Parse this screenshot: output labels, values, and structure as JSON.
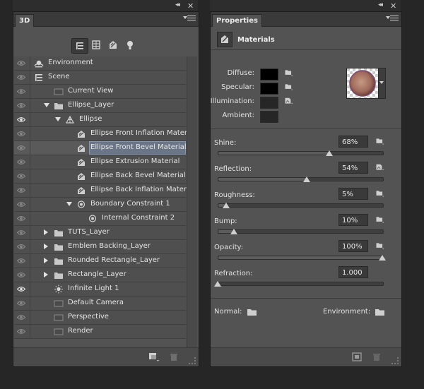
{
  "panel_3d": {
    "title": "3D",
    "filters": [
      {
        "name": "scene-filter-icon",
        "active": true
      },
      {
        "name": "mesh-filter-icon",
        "active": false
      },
      {
        "name": "material-filter-icon",
        "active": false
      },
      {
        "name": "light-filter-icon",
        "active": false
      }
    ],
    "rows": [
      {
        "label": "Environment",
        "depth": 0,
        "icon": "environment",
        "expand": "",
        "eye": true
      },
      {
        "label": "Scene",
        "depth": 0,
        "icon": "scene",
        "expand": "",
        "eye": true
      },
      {
        "label": "Current View",
        "depth": 1,
        "icon": "camera",
        "expand": "",
        "eye": true
      },
      {
        "label": "Ellipse_Layer",
        "depth": 1,
        "icon": "folder",
        "expand": "down",
        "eye": true
      },
      {
        "label": "Ellipse",
        "depth": 2,
        "icon": "mesh",
        "expand": "down",
        "eye": true
      },
      {
        "label": "Ellipse Front Inflation Material",
        "depth": 3,
        "icon": "material",
        "expand": "",
        "eye": true
      },
      {
        "label": "Ellipse Front Bevel Material",
        "depth": 3,
        "icon": "material",
        "expand": "",
        "eye": true,
        "selected": true
      },
      {
        "label": "Ellipse Extrusion Material",
        "depth": 3,
        "icon": "material",
        "expand": "",
        "eye": true
      },
      {
        "label": "Ellipse Back Bevel Material",
        "depth": 3,
        "icon": "material",
        "expand": "",
        "eye": true
      },
      {
        "label": "Ellipse Back Inflation Material",
        "depth": 3,
        "icon": "material",
        "expand": "",
        "eye": true
      },
      {
        "label": "Boundary Constraint 1",
        "depth": 3,
        "icon": "constraint",
        "expand": "down",
        "eye": true
      },
      {
        "label": "Internal Constraint 2",
        "depth": 4,
        "icon": "constraint",
        "expand": "",
        "eye": true
      },
      {
        "label": "TUTS_Layer",
        "depth": 1,
        "icon": "folder",
        "expand": "right",
        "eye": true
      },
      {
        "label": "Emblem Backing_Layer",
        "depth": 1,
        "icon": "folder",
        "expand": "right",
        "eye": true
      },
      {
        "label": "Rounded Rectangle_Layer",
        "depth": 1,
        "icon": "folder",
        "expand": "right",
        "eye": true
      },
      {
        "label": "Rectangle_Layer",
        "depth": 1,
        "icon": "folder",
        "expand": "right",
        "eye": true
      },
      {
        "label": "Infinite Light 1",
        "depth": 1,
        "icon": "light",
        "expand": "",
        "eye": true
      },
      {
        "label": "Default Camera",
        "depth": 1,
        "icon": "camera",
        "expand": "",
        "eye": true
      },
      {
        "label": "Perspective",
        "depth": 1,
        "icon": "camera",
        "expand": "",
        "eye": true
      },
      {
        "label": "Render",
        "depth": 1,
        "icon": "camera",
        "expand": "",
        "eye": true
      }
    ]
  },
  "properties": {
    "tab_title": "Properties",
    "section_title": "Materials",
    "colors": [
      {
        "label": "Diffuse:",
        "color": "#000000"
      },
      {
        "label": "Specular:",
        "color": "#000000"
      },
      {
        "label": "Illumination:",
        "color": "#262626"
      },
      {
        "label": "Ambient:",
        "color": "#262626"
      }
    ],
    "sliders": [
      {
        "label": "Shine:",
        "value": "68%",
        "level": 0.68
      },
      {
        "label": "Reflection:",
        "value": "54%",
        "level": 0.54
      },
      {
        "label": "Roughness:",
        "value": "5%",
        "level": 0.05
      },
      {
        "label": "Bump:",
        "value": "10%",
        "level": 0.1
      },
      {
        "label": "Opacity:",
        "value": "100%",
        "level": 1.0
      },
      {
        "label": "Refraction:",
        "value": "1.000",
        "level": 0.0
      }
    ],
    "normal_label": "Normal:",
    "environment_label": "Environment:"
  }
}
